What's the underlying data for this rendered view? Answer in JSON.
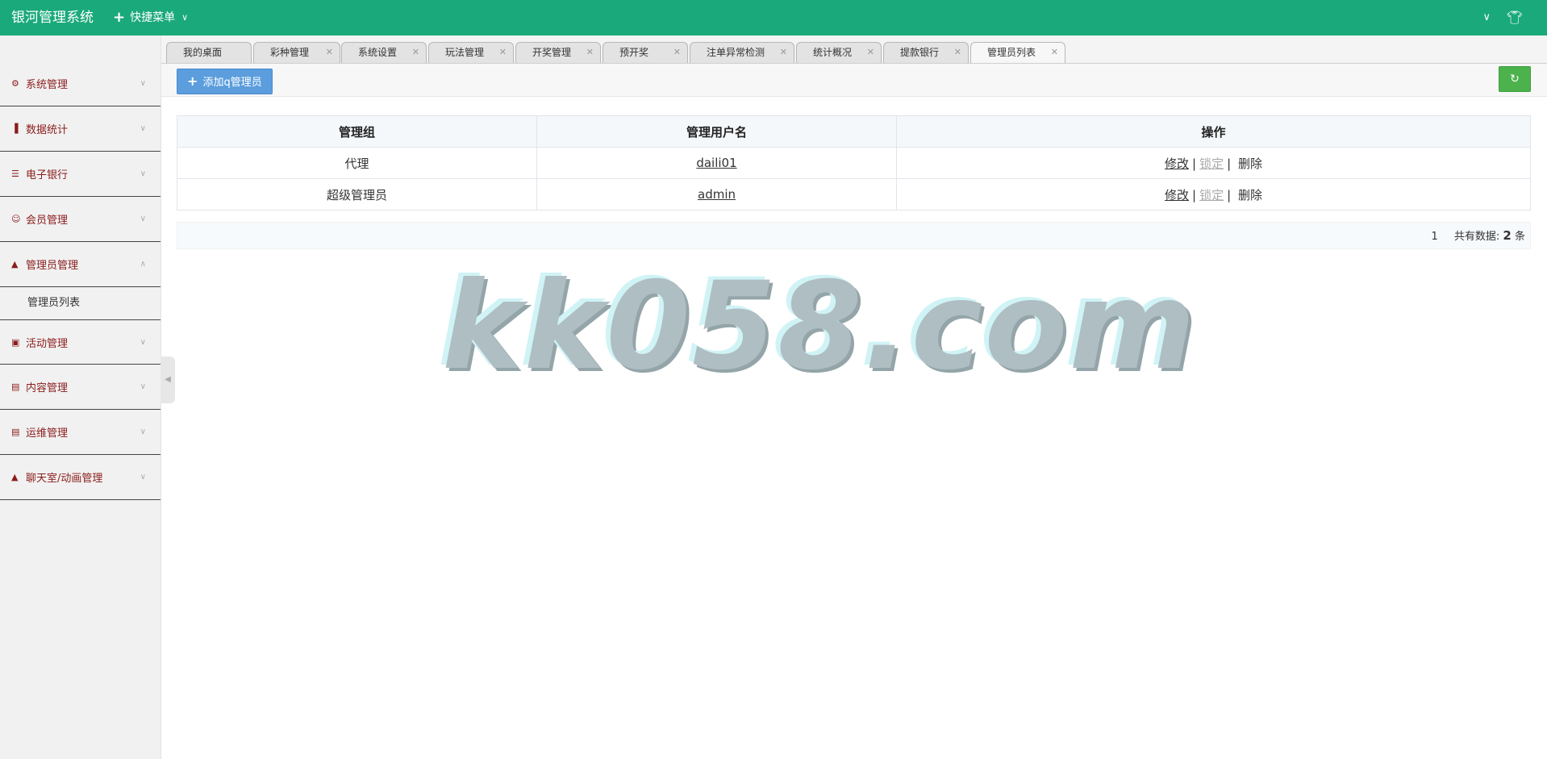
{
  "app": {
    "title": "银河管理系统",
    "quick_menu": "快捷菜单"
  },
  "colors": {
    "header": "#1aa97a",
    "add_button": "#5b9ddd",
    "refresh_button": "#4cb24c",
    "menu_text": "#8b1c1c"
  },
  "sidebar": {
    "items": [
      {
        "label": "系统管理",
        "icon": "gear-icon"
      },
      {
        "label": "数据统计",
        "icon": "bar-chart-icon"
      },
      {
        "label": "电子银行",
        "icon": "list-icon"
      },
      {
        "label": "会员管理",
        "icon": "user-outline-icon"
      },
      {
        "label": "管理员管理",
        "icon": "user-icon",
        "expanded": true,
        "children": [
          "管理员列表"
        ]
      },
      {
        "label": "活动管理",
        "icon": "gift-icon"
      },
      {
        "label": "内容管理",
        "icon": "book-icon"
      },
      {
        "label": "运维管理",
        "icon": "book-icon"
      },
      {
        "label": "聊天室/动画管理",
        "icon": "user-icon"
      }
    ]
  },
  "tabs": [
    {
      "label": "我的桌面"
    },
    {
      "label": "彩种管理"
    },
    {
      "label": "系统设置"
    },
    {
      "label": "玩法管理"
    },
    {
      "label": "开奖管理"
    },
    {
      "label": "预开奖"
    },
    {
      "label": "注单异常检测"
    },
    {
      "label": "统计概况"
    },
    {
      "label": "提款银行"
    },
    {
      "label": "管理员列表",
      "active": true
    }
  ],
  "toolbar": {
    "add_label": "添加q管理员"
  },
  "table": {
    "headers": [
      "管理组",
      "管理用户名",
      "操作"
    ],
    "rows": [
      {
        "group": "代理",
        "username": "daili01"
      },
      {
        "group": "超级管理员",
        "username": "admin"
      }
    ],
    "actions": {
      "edit": "修改",
      "lock": "锁定",
      "delete": "删除",
      "separator": "|"
    }
  },
  "pagination": {
    "page": "1",
    "total_label": "共有数据:",
    "total": "2",
    "unit": "条"
  },
  "watermark": "kk058.com"
}
